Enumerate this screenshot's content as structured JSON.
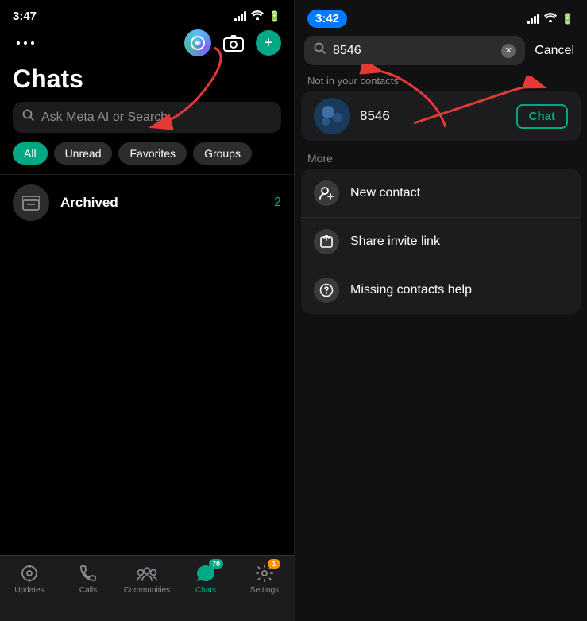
{
  "left": {
    "time": "3:47",
    "title": "Chats",
    "search_placeholder": "Ask Meta AI or Search",
    "filters": [
      {
        "label": "All",
        "active": true
      },
      {
        "label": "Unread",
        "active": false
      },
      {
        "label": "Favorites",
        "active": false
      },
      {
        "label": "Groups",
        "active": false
      }
    ],
    "archived": {
      "label": "Archived",
      "count": "2"
    },
    "tabs": [
      {
        "label": "Updates",
        "icon": "🔔",
        "active": false,
        "badge": null
      },
      {
        "label": "Calls",
        "icon": "📞",
        "active": false,
        "badge": null
      },
      {
        "label": "Communities",
        "icon": "👥",
        "active": false,
        "badge": null
      },
      {
        "label": "Chats",
        "icon": "💬",
        "active": true,
        "badge": "70"
      },
      {
        "label": "Settings",
        "icon": "⚙️",
        "active": false,
        "badge": "1"
      }
    ]
  },
  "right": {
    "time": "3:42",
    "search_query": "8546",
    "cancel_label": "Cancel",
    "not_in_contacts": "Not in your contacts",
    "result_number": "8546",
    "chat_btn_label": "Chat",
    "more_label": "More",
    "options": [
      {
        "icon": "👤+",
        "label": "New contact"
      },
      {
        "icon": "↑",
        "label": "Share invite link"
      },
      {
        "icon": "?",
        "label": "Missing contacts help"
      }
    ]
  }
}
